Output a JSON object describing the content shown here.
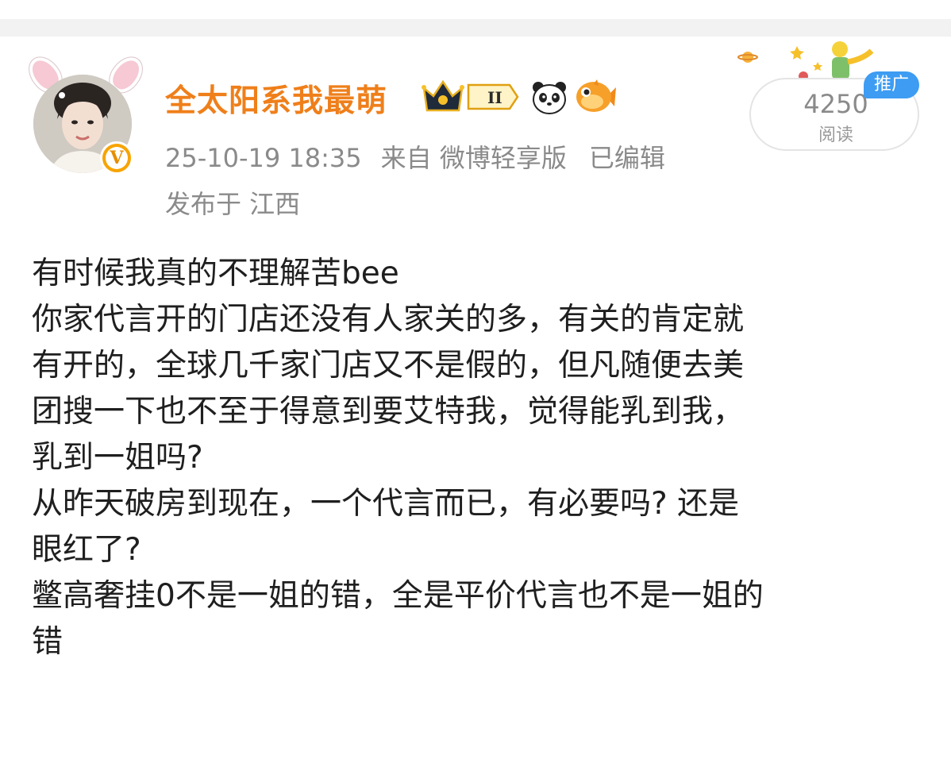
{
  "user": {
    "name": "全太阳系我最萌",
    "verified_mark": "V",
    "level_badge": "II"
  },
  "post_meta": {
    "timestamp": "25-10-19 18:35",
    "source": "来自 微博轻享版",
    "edited": "已编辑",
    "location": "发布于 江西"
  },
  "stats": {
    "reads_count": "4250",
    "reads_label": "阅读",
    "promo_tag": "推广"
  },
  "post": {
    "lines": [
      "有时候我真的不理解苦bee",
      "你家代言开的门店还没有人家关的多，有关的肯定就",
      "有开的，全球几千家门店又不是假的，但凡随便去美",
      "团搜一下也不至于得意到要艾特我，觉得能乳到我，",
      "乳到一姐吗?",
      "从昨天破房到现在，一个代言而已，有必要吗? 还是",
      "眼红了?",
      "鳖高奢挂0不是一姐的错，全是平价代言也不是一姐的",
      "错"
    ]
  },
  "icons": [
    "bunny-ears-decoration",
    "verified-badge-icon",
    "crown-level-badge",
    "panda-icon",
    "pufferfish-icon",
    "little-prince-decoration"
  ],
  "colors": {
    "username": "#ef7f1a",
    "meta": "#8a8a8a",
    "promo": "#3e9cf2",
    "verified": "#f7a400"
  }
}
